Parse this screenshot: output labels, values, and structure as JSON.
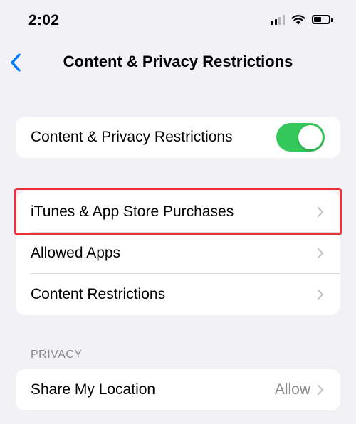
{
  "status_bar": {
    "time": "2:02",
    "battery_level": 0.45
  },
  "nav": {
    "title": "Content & Privacy Restrictions",
    "back_icon": "chevron-left-icon"
  },
  "main_toggle": {
    "label": "Content & Privacy Restrictions",
    "on": true
  },
  "store_group": {
    "items": [
      {
        "label": "iTunes & App Store Purchases"
      },
      {
        "label": "Allowed Apps"
      },
      {
        "label": "Content Restrictions"
      }
    ]
  },
  "privacy": {
    "header": "PRIVACY",
    "items": [
      {
        "label": "Share My Location",
        "value": "Allow"
      }
    ]
  },
  "colors": {
    "accent": "#007aff",
    "toggle_on": "#34c759",
    "highlight": "#e8323c",
    "background": "#f1f1f6"
  }
}
